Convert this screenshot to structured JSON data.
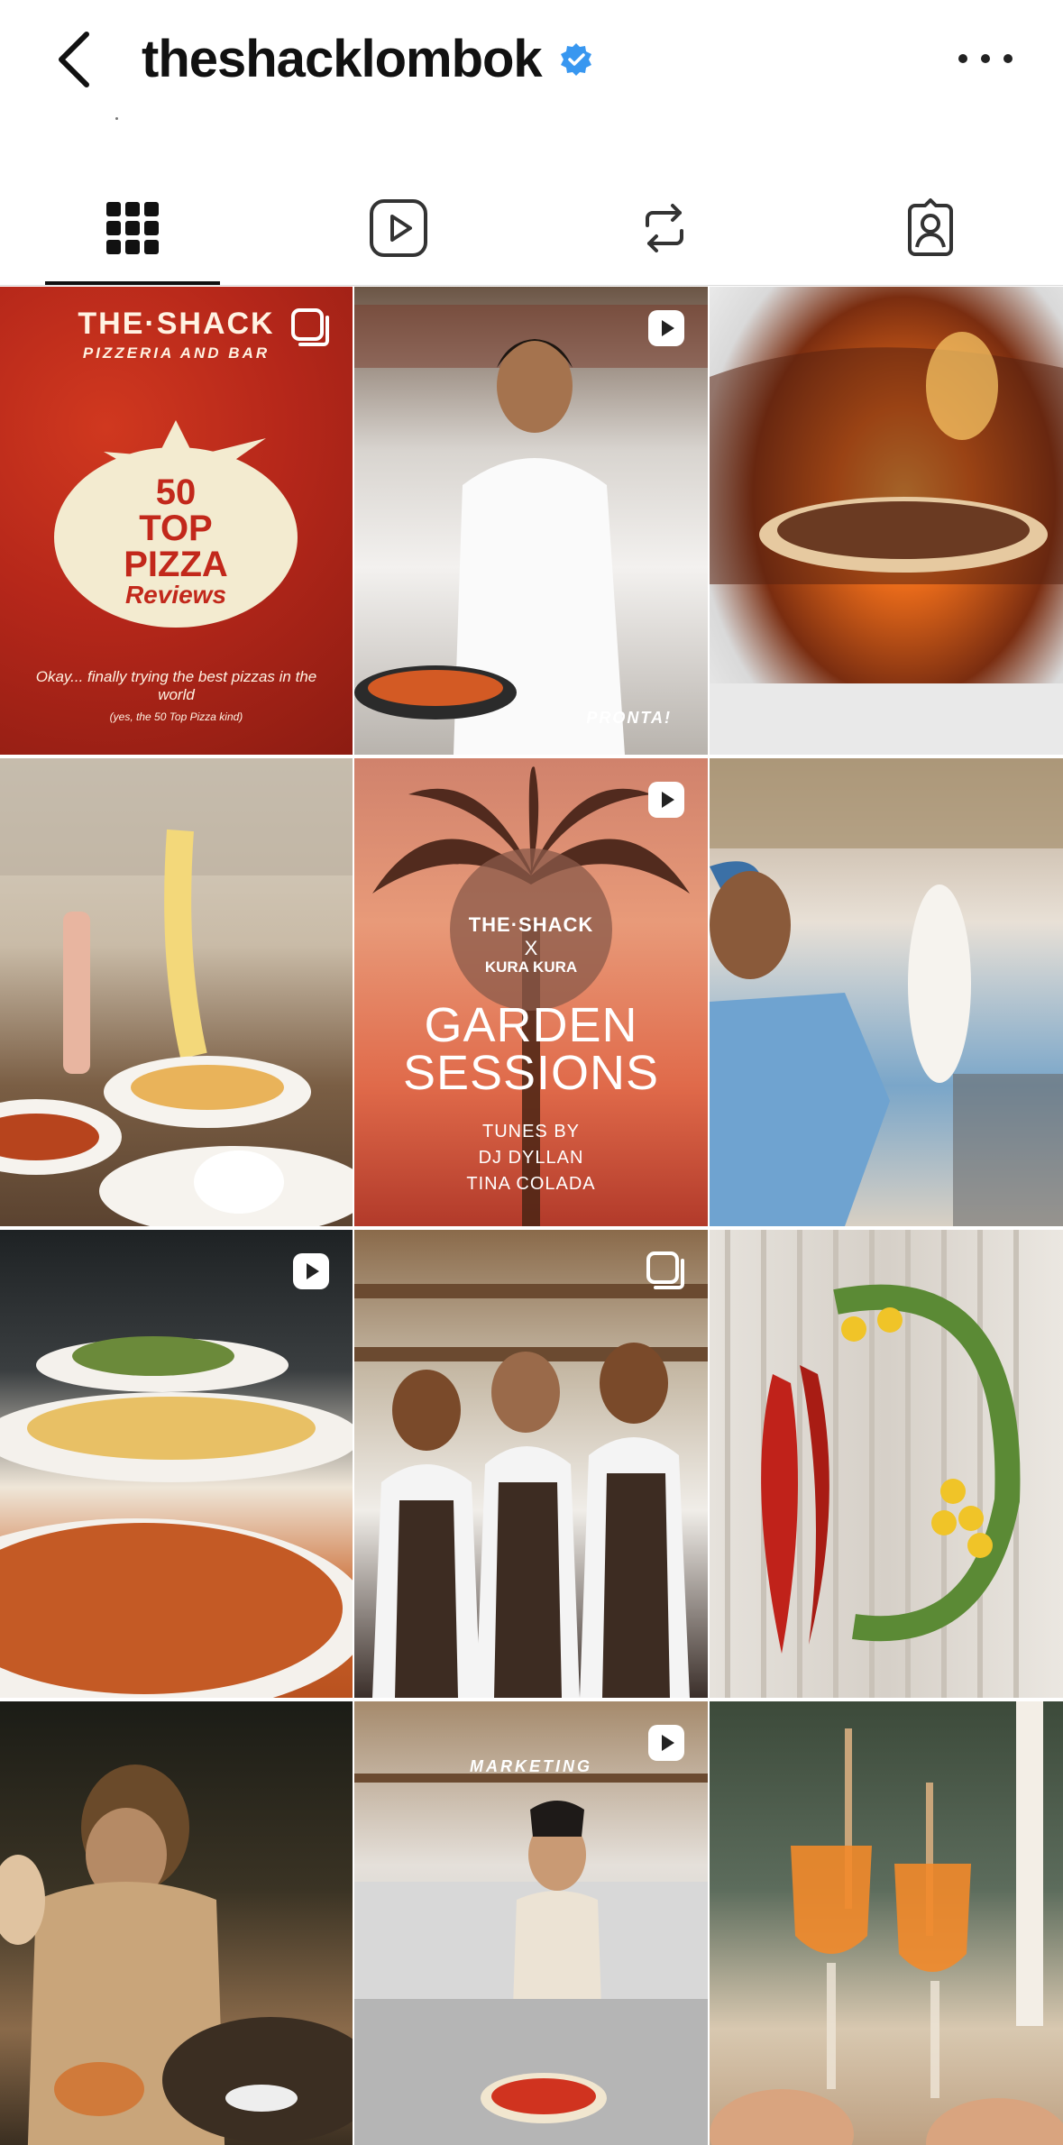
{
  "header": {
    "title": "theshacklombok",
    "verified": true
  },
  "tabs": [
    {
      "name": "grid-icon",
      "active": true
    },
    {
      "name": "reels-icon",
      "active": false
    },
    {
      "name": "reposts-icon",
      "active": false
    },
    {
      "name": "tagged-icon",
      "active": false
    }
  ],
  "posts": {
    "p1": {
      "brand": "THE·SHACK",
      "sub": "PIZZERIA AND BAR",
      "badge_line1": "50",
      "badge_line2": "TOP",
      "badge_line3": "PIZZA",
      "reviews": "Reviews",
      "caption": "Okay... finally trying the best pizzas in the world",
      "note": "(yes, the 50 Top Pizza kind)",
      "type": "carousel"
    },
    "p2": {
      "overlay": "PRONTA!",
      "type": "reel"
    },
    "p3": {
      "type": "photo"
    },
    "p4": {
      "type": "photo"
    },
    "p5": {
      "brand": "THE·SHACK",
      "x": "X",
      "partner": "KURA KURA",
      "headline": "GARDEN SESSIONS",
      "tunes": "TUNES BY",
      "dj1": "DJ DYLLAN",
      "dj2": "TINA COLADA",
      "type": "reel"
    },
    "p6": {
      "type": "photo"
    },
    "p7": {
      "type": "reel"
    },
    "p8": {
      "type": "carousel"
    },
    "p9": {
      "type": "photo"
    },
    "p10": {
      "type": "photo"
    },
    "p11": {
      "overlay": "MARKETING",
      "type": "reel"
    },
    "p12": {
      "type": "photo"
    }
  },
  "colors": {
    "accent": "#111111",
    "verified": "#3897f0",
    "sauce": "#c2281b"
  }
}
